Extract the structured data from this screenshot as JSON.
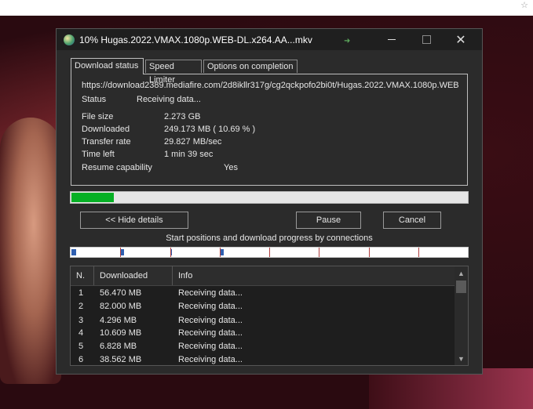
{
  "window": {
    "title": "10% Hugas.2022.VMAX.1080p.WEB-DL.x264.AA...mkv",
    "controls": {
      "minimize": "minimize",
      "maximize": "maximize",
      "close": "✕"
    }
  },
  "tabs": [
    {
      "label": "Download status",
      "active": true
    },
    {
      "label": "Speed Limiter",
      "active": false
    },
    {
      "label": "Options on completion",
      "active": false
    }
  ],
  "status": {
    "url": "https://download2389.mediafire.com/2d8ikllr317g/cg2qckpofo2bi0t/Hugas.2022.VMAX.1080p.WEB-",
    "status_label": "Status",
    "status_value": "Receiving data...",
    "file_size_label": "File size",
    "file_size_value": "2.273  GB",
    "downloaded_label": "Downloaded",
    "downloaded_value": "249.173  MB  ( 10.69 % )",
    "transfer_rate_label": "Transfer rate",
    "transfer_rate_value": "29.827  MB/sec",
    "time_left_label": "Time left",
    "time_left_value": "1 min 39 sec",
    "resume_label": "Resume capability",
    "resume_value": "Yes"
  },
  "progress": {
    "fraction": 0.1069
  },
  "buttons": {
    "hide_details": "<< Hide details",
    "pause": "Pause",
    "cancel": "Cancel"
  },
  "connections_title": "Start positions and download progress by connections",
  "connections_progress": [
    0.1,
    0.06,
    0.01,
    0.06,
    0,
    0,
    0,
    0
  ],
  "table": {
    "columns": [
      "N.",
      "Downloaded",
      "Info"
    ],
    "rows": [
      {
        "n": "1",
        "downloaded": "56.470  MB",
        "info": "Receiving data..."
      },
      {
        "n": "2",
        "downloaded": "82.000  MB",
        "info": "Receiving data..."
      },
      {
        "n": "3",
        "downloaded": "4.296  MB",
        "info": "Receiving data..."
      },
      {
        "n": "4",
        "downloaded": "10.609  MB",
        "info": "Receiving data..."
      },
      {
        "n": "5",
        "downloaded": "6.828  MB",
        "info": "Receiving data..."
      },
      {
        "n": "6",
        "downloaded": "38.562  MB",
        "info": "Receiving data..."
      }
    ]
  },
  "colors": {
    "progress_fill": "#06b025",
    "connection_fill": "#2f5fb0",
    "connection_sep": "#b04040"
  }
}
